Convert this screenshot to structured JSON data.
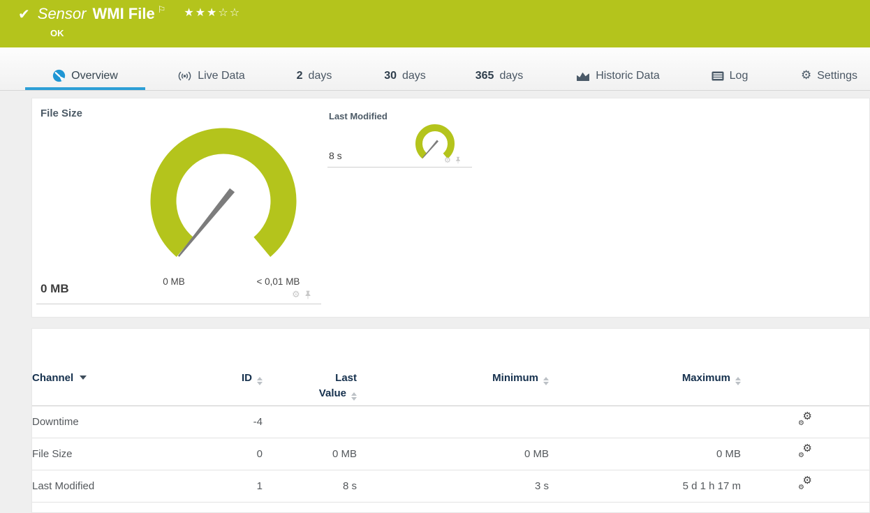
{
  "colors": {
    "brand_green": "#b4c41c",
    "accent_blue": "#2d9fd6",
    "tab_icon_gray": "#4b5a68",
    "table_header_text": "#15304d"
  },
  "header": {
    "check_glyph": "✔",
    "sensor_kind": "Sensor",
    "sensor_name": "WMI File",
    "flag_glyph": "⚐",
    "rating": {
      "filled": "★★★",
      "empty": "☆☆"
    },
    "status": "OK"
  },
  "icons": {
    "gear_glyph": "⚙"
  },
  "tabs": {
    "items": [
      {
        "label": "Overview",
        "icon": "gauge-icon",
        "active": true
      },
      {
        "label": "Live Data",
        "icon": "broadcast-icon"
      },
      {
        "number": "2",
        "label": "days"
      },
      {
        "number": "30",
        "label": "days"
      },
      {
        "number": "365",
        "label": "days"
      },
      {
        "label": "Historic Data",
        "icon": "area-chart-icon"
      },
      {
        "label": "Log",
        "icon": "log-icon"
      },
      {
        "label": "Settings",
        "icon": "gear-icon"
      }
    ]
  },
  "gauges": {
    "file_size": {
      "title": "File Size",
      "value": "0 MB",
      "scale_min": "0 MB",
      "scale_max": "< 0,01 MB"
    },
    "last_modified": {
      "title": "Last Modified",
      "value": "8 s"
    }
  },
  "table": {
    "columns": {
      "channel": "Channel",
      "id": "ID",
      "last_value_line1": "Last",
      "last_value_line2": "Value",
      "minimum": "Minimum",
      "maximum": "Maximum"
    },
    "rows": [
      {
        "channel": "Downtime",
        "id": "-4",
        "last_value": "",
        "minimum": "",
        "maximum": ""
      },
      {
        "channel": "File Size",
        "id": "0",
        "last_value": "0 MB",
        "minimum": "0 MB",
        "maximum": "0 MB"
      },
      {
        "channel": "Last Modified",
        "id": "1",
        "last_value": "8 s",
        "minimum": "3 s",
        "maximum": "5 d 1 h 17 m"
      }
    ]
  }
}
